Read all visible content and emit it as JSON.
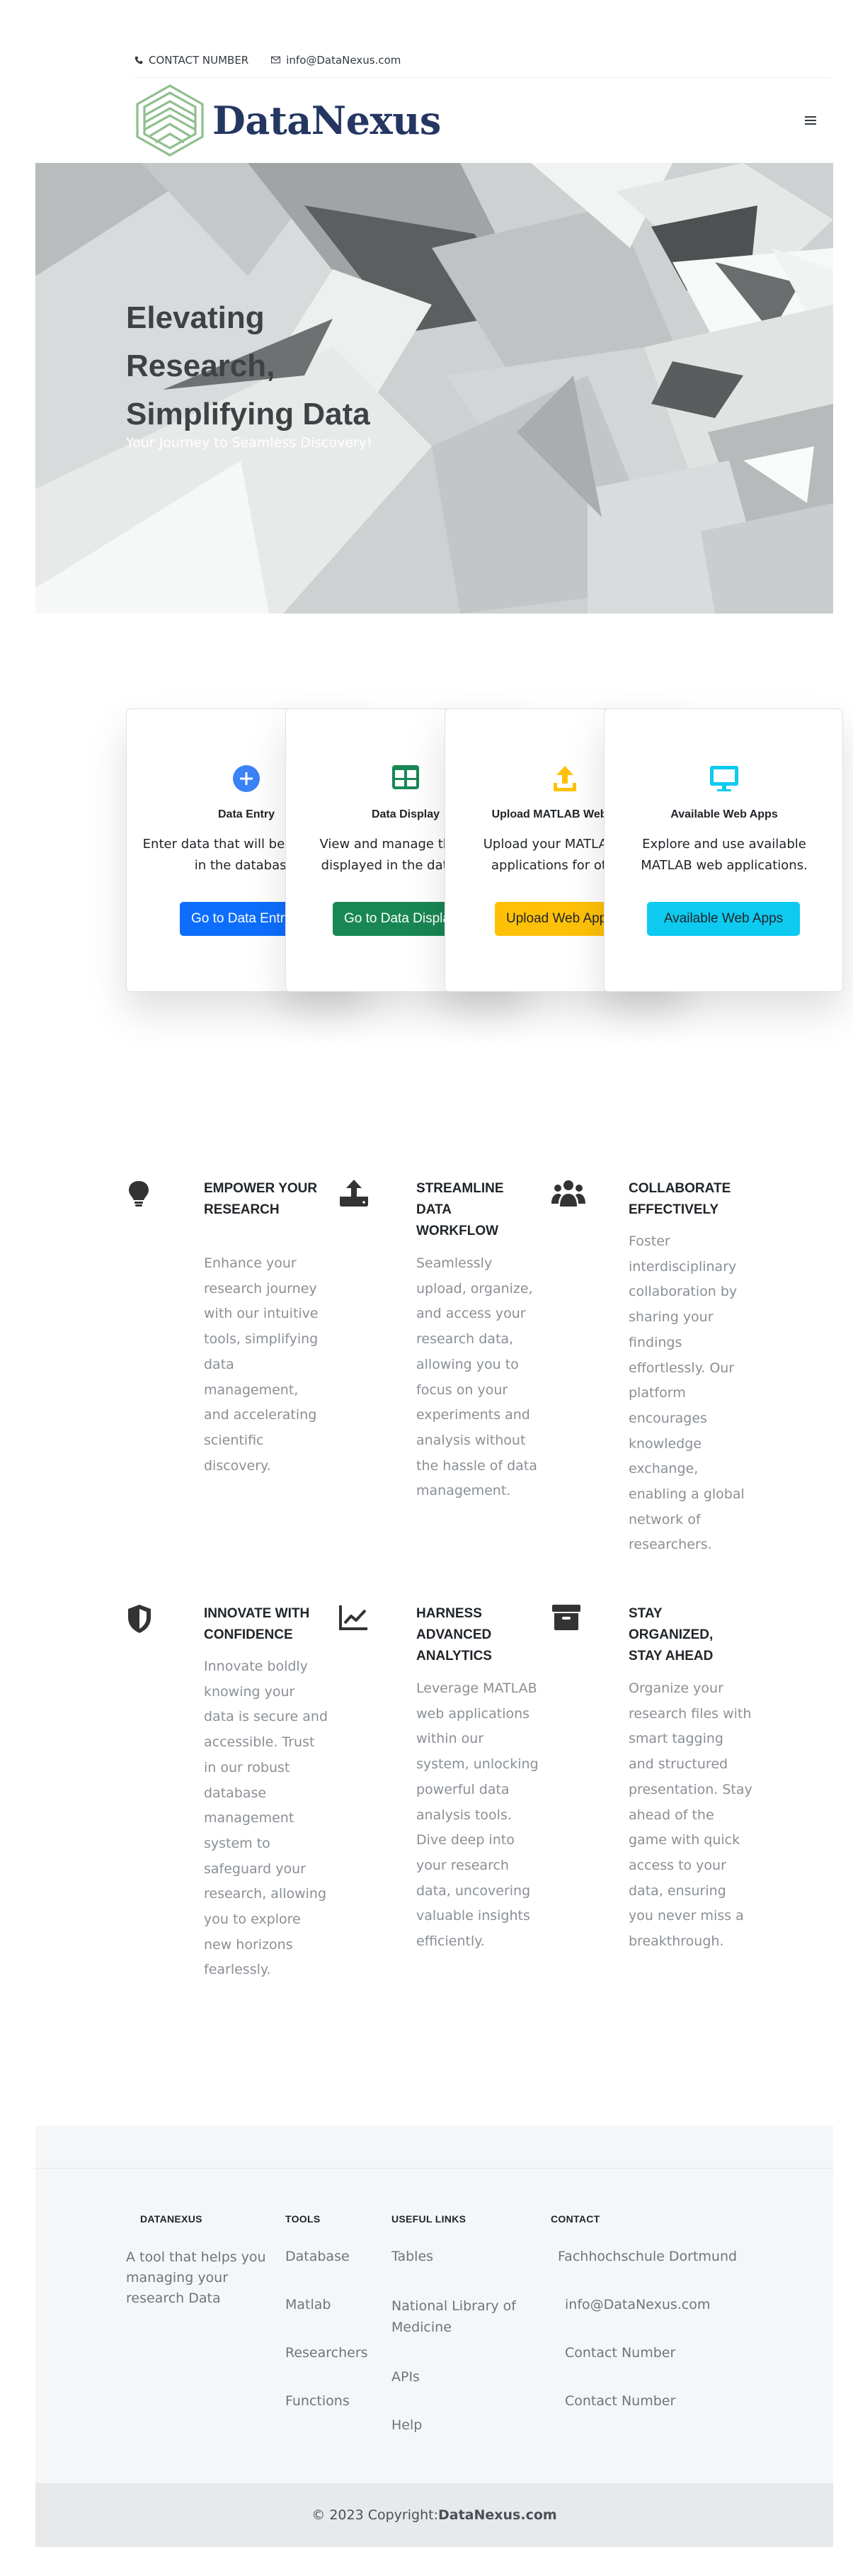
{
  "topbar": {
    "phone_label": "CONTACT NUMBER",
    "email": "info@DataNexus.com"
  },
  "header": {
    "brand_name": "DataNexus",
    "logo_icon": "stacked-layers-logo",
    "menu_icon": "hamburger-icon"
  },
  "hero": {
    "title_line1": "Elevating",
    "title_line2": "Research,",
    "title_line3": "Simplifying Data",
    "subtitle": "Your Journey to Seamless Discovery!"
  },
  "cards": [
    {
      "icon": "plus-circle-icon",
      "title": "Data Entry",
      "text": "Enter data that will be displayed in the database.",
      "button": "Go to Data Entry",
      "color": "#0d6efd"
    },
    {
      "icon": "table-icon",
      "title": "Data Display",
      "text": "View and manage the data displayed in the database.",
      "button": "Go to Data Display",
      "color": "#198754"
    },
    {
      "icon": "upload-icon",
      "title": "Upload MATLAB Web Apps",
      "text": "Upload your MATLAB web applications for others.",
      "button": "Upload Web Apps",
      "color": "#ffc107"
    },
    {
      "icon": "monitor-icon",
      "title": "Available Web Apps",
      "text": "Explore and use available MATLAB web applications.",
      "button": "Available Web Apps",
      "color": "#0dcaf0"
    }
  ],
  "features": [
    {
      "icon": "lightbulb-icon",
      "title": "EMPOWER YOUR RESEARCH",
      "text": "Enhance your research journey with our intuitive tools, simplifying data management, and accelerating scientific discovery."
    },
    {
      "icon": "upload-tray-icon",
      "title": "STREAMLINE DATA WORKFLOW",
      "text": "Seamlessly upload, organize, and access your research data, allowing you to focus on your experiments and analysis without the hassle of data management."
    },
    {
      "icon": "users-icon",
      "title": "COLLABORATE EFFECTIVELY",
      "text": "Foster interdisciplinary collaboration by sharing your findings effortlessly. Our platform encourages knowledge exchange, enabling a global network of researchers."
    },
    {
      "icon": "shield-icon",
      "title": "INNOVATE WITH CONFIDENCE",
      "text": "Innovate boldly knowing your data is secure and accessible. Trust in our robust database management system to safeguard your research, allowing you to explore new horizons fearlessly."
    },
    {
      "icon": "line-chart-icon",
      "title": "HARNESS ADVANCED ANALYTICS",
      "text": "Leverage MATLAB web applications within our system, unlocking powerful data analysis tools. Dive deep into your research data, uncovering valuable insights efficiently."
    },
    {
      "icon": "archive-icon",
      "title": "STAY ORGANIZED, STAY AHEAD",
      "text": "Organize your research files with smart tagging and structured presentation. Stay ahead of the game with quick access to your data, ensuring you never miss a breakthrough."
    }
  ],
  "footer": {
    "about": {
      "heading": "DATANEXUS",
      "text": "A tool that helps you managing your research Data"
    },
    "tools": {
      "heading": "TOOLS",
      "links": [
        "Database",
        "Matlab",
        "Researchers",
        "Functions"
      ]
    },
    "useful": {
      "heading": "USEFUL LINKS",
      "links": [
        "Tables",
        "National Library of Medicine",
        "APIs",
        "Help"
      ]
    },
    "contact": {
      "heading": "CONTACT",
      "links": [
        "Fachhochschule Dortmund",
        "info@DataNexus.com",
        "Contact Number",
        "Contact Number"
      ]
    }
  },
  "copyright": {
    "prefix": "© 2023 Copyright:",
    "site": "DataNexus.com"
  },
  "colors": {
    "brand": "#243661",
    "logo": "#8fbf8f",
    "primary": "#0d6efd",
    "success": "#198754",
    "warning": "#ffc107",
    "info": "#0dcaf0",
    "muted": "#8a8f94"
  }
}
